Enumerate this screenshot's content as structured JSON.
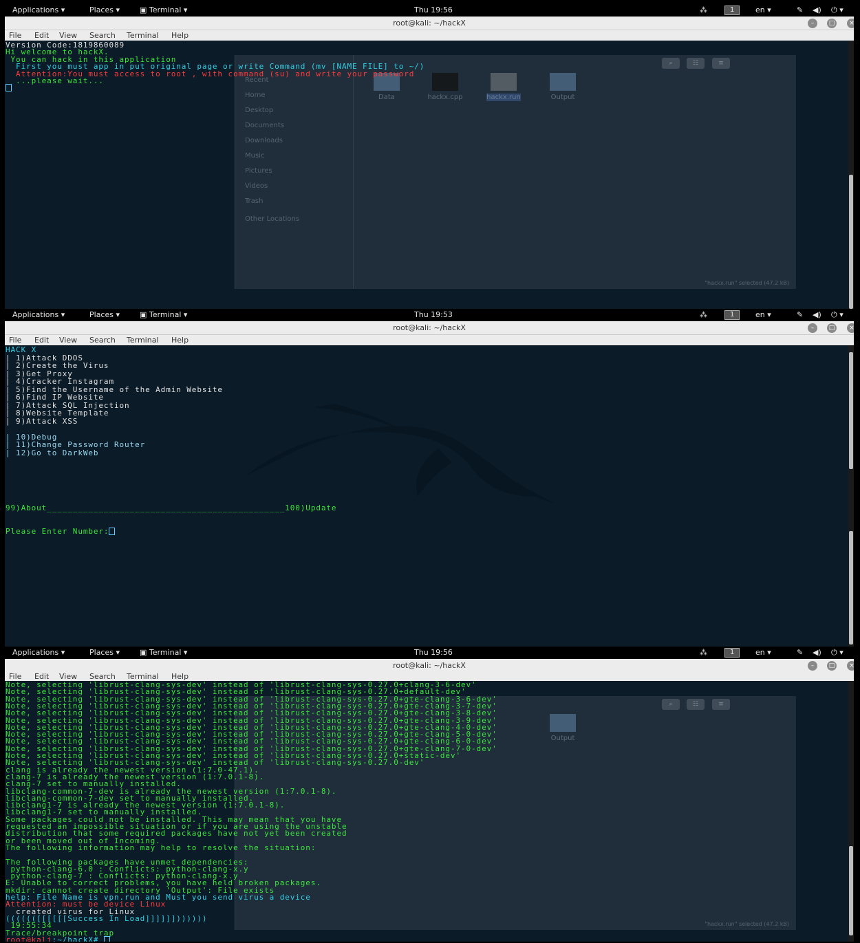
{
  "topbar": {
    "applications": "Applications",
    "places": "Places",
    "terminal": "Terminal",
    "workspace": "1",
    "lang": "en"
  },
  "window": {
    "title": "root@kali: ~/hackX"
  },
  "menu": [
    "File",
    "Edit",
    "View",
    "Search",
    "Terminal",
    "Help"
  ],
  "colors": {
    "terminal_bg": "#0b1b28",
    "green": "#3de53d",
    "cyan": "#33d0e6",
    "red": "#ff3b3b"
  },
  "files": {
    "sidebar": [
      "Recent",
      "Home",
      "Desktop",
      "Documents",
      "Downloads",
      "Music",
      "Pictures",
      "Videos",
      "Trash",
      "Other Locations"
    ],
    "icons": [
      "Data",
      "hackx.cpp",
      "hackx.run",
      "Output"
    ],
    "status": "\"hackx.run\" selected (47.2 kB)"
  },
  "shot1": {
    "clock": "Thu 19:56",
    "lines": [
      {
        "t": "Version Code:1819860089",
        "c": "w"
      },
      {
        "t": "Hi welcome to hackX.",
        "c": "g"
      },
      {
        "t": " You can hack in this application",
        "c": "g"
      },
      {
        "t": "  First you must app in put original page or write Command (mv [NAME FILE] to ~/)",
        "c": "c"
      },
      {
        "t": "  Attention:You must access to root , with command (su) and write your password",
        "c": "r"
      },
      {
        "t": "  ...please wait...",
        "c": "g"
      }
    ]
  },
  "shot2": {
    "clock": "Thu 19:53",
    "lines": [
      {
        "t": "HACK X",
        "c": "c"
      },
      {
        "t": "| 1)Attack DDOS",
        "c": "w"
      },
      {
        "t": "| 2)Create the Virus",
        "c": "w"
      },
      {
        "t": "| 3)Get Proxy",
        "c": "w"
      },
      {
        "t": "| 4)Cracker Instagram",
        "c": "w"
      },
      {
        "t": "| 5)Find the Username of the Admin Website",
        "c": "w"
      },
      {
        "t": "| 6)Find IP Website",
        "c": "w"
      },
      {
        "t": "| 7)Attack SQL Injection",
        "c": "w"
      },
      {
        "t": "| 8)Website Template",
        "c": "w"
      },
      {
        "t": "| 9)Attack XSS",
        "c": "w"
      },
      {
        "t": "",
        "c": "w"
      },
      {
        "t": "| 10)Debug",
        "c": "b"
      },
      {
        "t": "| 11)Change Password Router",
        "c": "b"
      },
      {
        "t": "| 12)Go to DarkWeb",
        "c": "b"
      }
    ],
    "about": "99)About______________________________________________100)Update",
    "prompt": "Please Enter Number:"
  },
  "shot3": {
    "clock": "Thu 19:56",
    "lines": [
      {
        "t": "Note, selecting 'librust-clang-sys-dev' instead of 'librust-clang-sys-0.27.0+clang-3-6-dev'",
        "c": "g"
      },
      {
        "t": "Note, selecting 'librust-clang-sys-dev' instead of 'librust-clang-sys-0.27.0+default-dev'",
        "c": "g"
      },
      {
        "t": "Note, selecting 'librust-clang-sys-dev' instead of 'librust-clang-sys-0.27.0+gte-clang-3-6-dev'",
        "c": "g"
      },
      {
        "t": "Note, selecting 'librust-clang-sys-dev' instead of 'librust-clang-sys-0.27.0+gte-clang-3-7-dev'",
        "c": "g"
      },
      {
        "t": "Note, selecting 'librust-clang-sys-dev' instead of 'librust-clang-sys-0.27.0+gte-clang-3-8-dev'",
        "c": "g"
      },
      {
        "t": "Note, selecting 'librust-clang-sys-dev' instead of 'librust-clang-sys-0.27.0+gte-clang-3-9-dev'",
        "c": "g"
      },
      {
        "t": "Note, selecting 'librust-clang-sys-dev' instead of 'librust-clang-sys-0.27.0+gte-clang-4-0-dev'",
        "c": "g"
      },
      {
        "t": "Note, selecting 'librust-clang-sys-dev' instead of 'librust-clang-sys-0.27.0+gte-clang-5-0-dev'",
        "c": "g"
      },
      {
        "t": "Note, selecting 'librust-clang-sys-dev' instead of 'librust-clang-sys-0.27.0+gte-clang-6-0-dev'",
        "c": "g"
      },
      {
        "t": "Note, selecting 'librust-clang-sys-dev' instead of 'librust-clang-sys-0.27.0+gte-clang-7-0-dev'",
        "c": "g"
      },
      {
        "t": "Note, selecting 'librust-clang-sys-dev' instead of 'librust-clang-sys-0.27.0+static-dev'",
        "c": "g"
      },
      {
        "t": "Note, selecting 'librust-clang-sys-dev' instead of 'librust-clang-sys-0.27.0-dev'",
        "c": "g"
      },
      {
        "t": "clang is already the newest version (1:7.0-47.1).",
        "c": "g"
      },
      {
        "t": "clang-7 is already the newest version (1:7.0.1-8).",
        "c": "g"
      },
      {
        "t": "clang-7 set to manually installed.",
        "c": "g"
      },
      {
        "t": "libclang-common-7-dev is already the newest version (1:7.0.1-8).",
        "c": "g"
      },
      {
        "t": "libclang-common-7-dev set to manually installed.",
        "c": "g"
      },
      {
        "t": "libclang1-7 is already the newest version (1:7.0.1-8).",
        "c": "g"
      },
      {
        "t": "libclang1-7 set to manually installed.",
        "c": "g"
      },
      {
        "t": "Some packages could not be installed. This may mean that you have",
        "c": "g"
      },
      {
        "t": "requested an impossible situation or if you are using the unstable",
        "c": "g"
      },
      {
        "t": "distribution that some required packages have not yet been created",
        "c": "g"
      },
      {
        "t": "or been moved out of Incoming.",
        "c": "g"
      },
      {
        "t": "The following information may help to resolve the situation:",
        "c": "g"
      },
      {
        "t": "",
        "c": "g"
      },
      {
        "t": "The following packages have unmet dependencies:",
        "c": "g"
      },
      {
        "t": " python-clang-6.0 : Conflicts: python-clang-x.y",
        "c": "g"
      },
      {
        "t": " python-clang-7 : Conflicts: python-clang-x.y",
        "c": "g"
      },
      {
        "t": "E: Unable to correct problems, you have held broken packages.",
        "c": "g"
      },
      {
        "t": "mkdir: cannot create directory 'Output': File exists",
        "c": "g"
      },
      {
        "t": "help: File Name is vpn.run and Must you send virus a device",
        "c": "c"
      },
      {
        "t": "Attention: must be device Linux",
        "c": "r"
      },
      {
        "t": "  created virus for Linux",
        "c": "w"
      },
      {
        "t": "(((((([[[[[[Success In Load]]]]]]))))))",
        "c": "c"
      },
      {
        "t": " 19:55:34",
        "c": "g"
      },
      {
        "t": "Trace/breakpoint trap",
        "c": "g"
      }
    ],
    "prompt_user": "root@kali",
    "prompt_path": ":~/hackX# "
  }
}
